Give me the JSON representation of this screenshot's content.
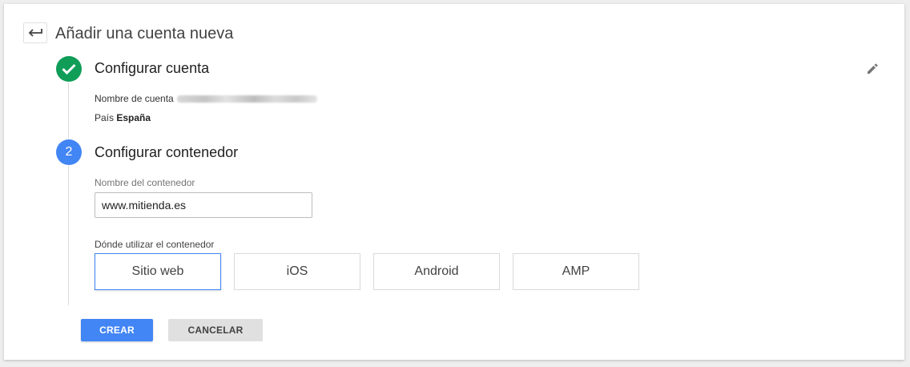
{
  "header": {
    "title": "Añadir una cuenta nueva",
    "back_icon": "arrow-back-icon"
  },
  "step1": {
    "title": "Configurar cuenta",
    "status_icon": "check-icon",
    "edit_icon": "pencil-icon",
    "account_label": "Nombre de cuenta",
    "country_label": "País",
    "country_value": "España"
  },
  "step2": {
    "number": "2",
    "title": "Configurar contenedor",
    "container_name_label": "Nombre del contenedor",
    "container_name_value": "www.mitienda.es",
    "usage_label": "Dónde utilizar el contenedor",
    "platforms": [
      {
        "label": "Sitio web",
        "selected": true
      },
      {
        "label": "iOS",
        "selected": false
      },
      {
        "label": "Android",
        "selected": false
      },
      {
        "label": "AMP",
        "selected": false
      }
    ]
  },
  "actions": {
    "create_label": "CREAR",
    "cancel_label": "CANCELAR"
  },
  "colors": {
    "success": "#0f9d58",
    "primary": "#4285f4",
    "cancel_bg": "#e0e0e0"
  }
}
